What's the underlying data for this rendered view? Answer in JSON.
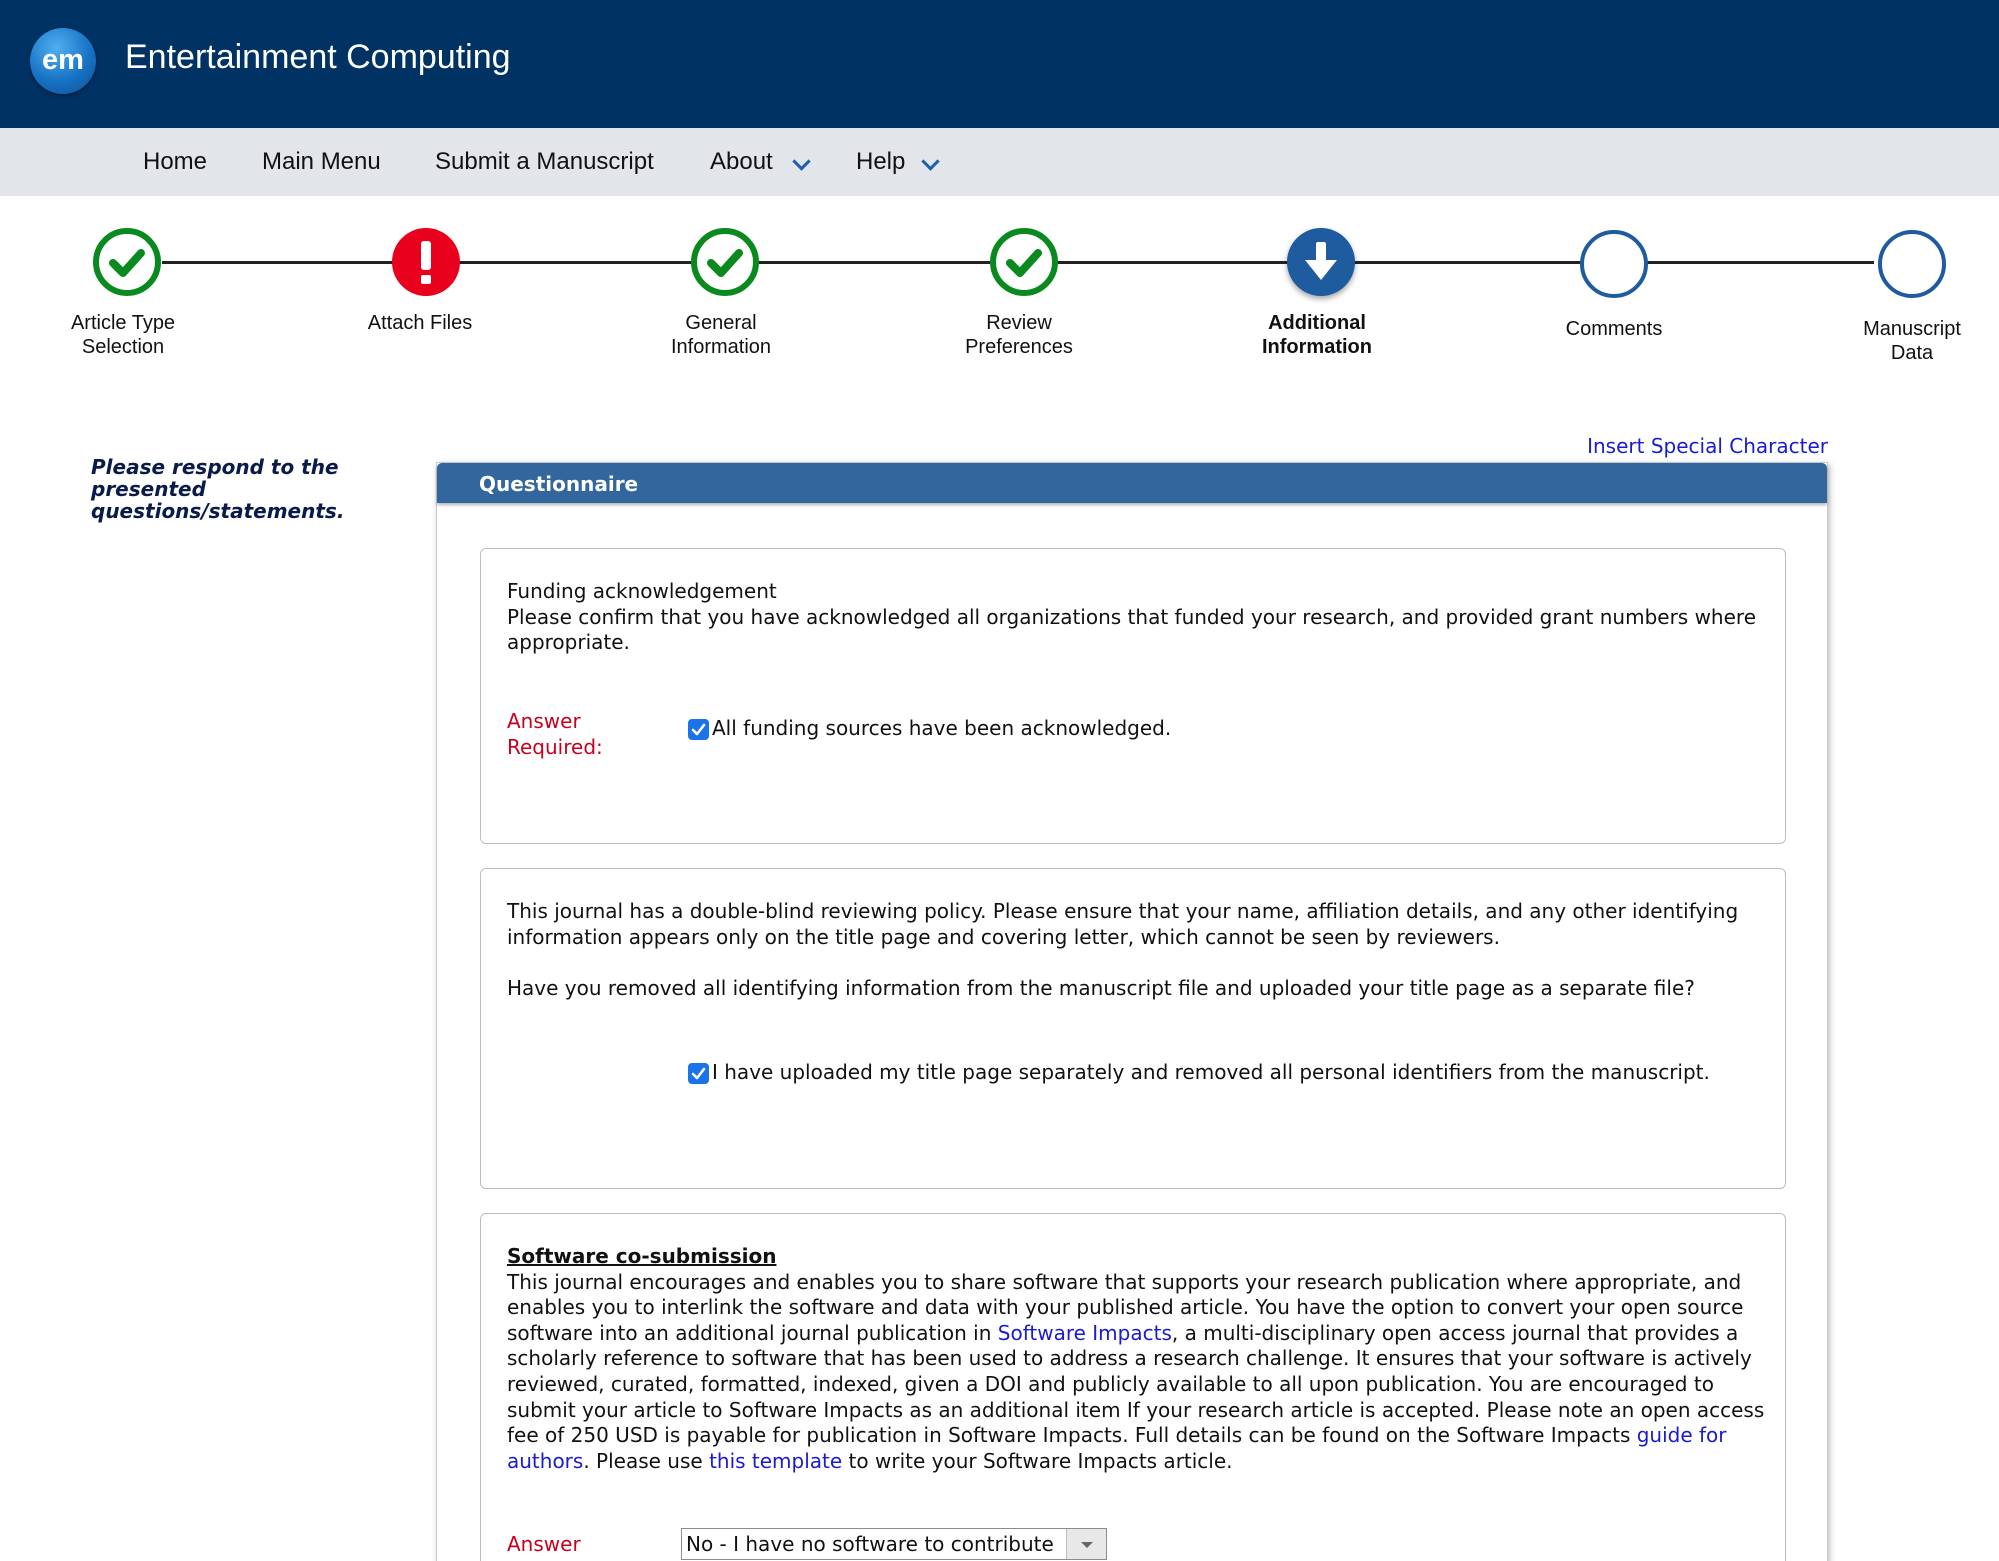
{
  "header": {
    "logo_text": "em",
    "title": "Entertainment Computing",
    "background": "#003264"
  },
  "nav": {
    "items": [
      {
        "label": "Home"
      },
      {
        "label": "Main Menu"
      },
      {
        "label": "Submit a Manuscript"
      },
      {
        "label": "About",
        "has_dropdown": true
      },
      {
        "label": "Help",
        "has_dropdown": true
      }
    ]
  },
  "steps": [
    {
      "label_line1": "Article Type",
      "label_line2": "Selection",
      "status": "complete",
      "icon": "check-icon"
    },
    {
      "label_line1": "Attach Files",
      "label_line2": "",
      "status": "error",
      "icon": "exclamation-icon"
    },
    {
      "label_line1": "General",
      "label_line2": "Information",
      "status": "complete",
      "icon": "check-icon"
    },
    {
      "label_line1": "Review",
      "label_line2": "Preferences",
      "status": "complete",
      "icon": "check-icon"
    },
    {
      "label_line1": "Additional",
      "label_line2": "Information",
      "status": "current",
      "icon": "arrow-down-icon"
    },
    {
      "label_line1": "Comments",
      "label_line2": "",
      "status": "pending",
      "icon": ""
    },
    {
      "label_line1": "Manuscript",
      "label_line2": "Data",
      "status": "pending",
      "icon": ""
    }
  ],
  "sidebar_note": "Please respond to the presented questions/statements.",
  "insert_special_character": "Insert Special Character",
  "panel": {
    "title": "Questionnaire",
    "questions": [
      {
        "heading": "Funding acknowledgement",
        "text": "Please confirm that you have acknowledged all organizations that funded your research, and provided grant numbers where appropriate.",
        "answer_required": "Answer Required:",
        "checkbox_label": "All funding sources have been acknowledged.",
        "checked": true
      },
      {
        "text1": "This journal has a double-blind reviewing policy. Please ensure that your name, affiliation details, and any other identifying information appears only on the title page and covering letter, which cannot be seen by reviewers.",
        "text2": "Have you removed all identifying information from the manuscript file and uploaded your title page as a separate file?",
        "checkbox_label": "I have uploaded my title page separately and removed all personal identifiers from the manuscript.",
        "checked": true
      },
      {
        "heading": "Software co-submission",
        "text_a": "This journal encourages and enables you to share software that supports your research publication where appropriate, and enables you to interlink the software and data with your published article. You have the option to convert your open source software into an additional journal publication in ",
        "link1": "Software Impacts",
        "text_b": ", a multi-disciplinary open access journal that provides a scholarly reference to software that has been used to address a research challenge. It ensures that your software is actively reviewed, curated, formatted, indexed, given a DOI and publicly available to all upon publication. You are encouraged to submit your article to Software Impacts as an additional item If your research article is accepted. Please note an open access fee of 250 USD is payable for publication in Software Impacts. Full details can be found on the Software Impacts ",
        "link2": "guide for authors",
        "text_c": ". Please use ",
        "link3": "this template",
        "text_d": " to write your Software Impacts article.",
        "answer_required": "Answer Required:",
        "select_value": "No - I have no software to contribute"
      }
    ]
  }
}
